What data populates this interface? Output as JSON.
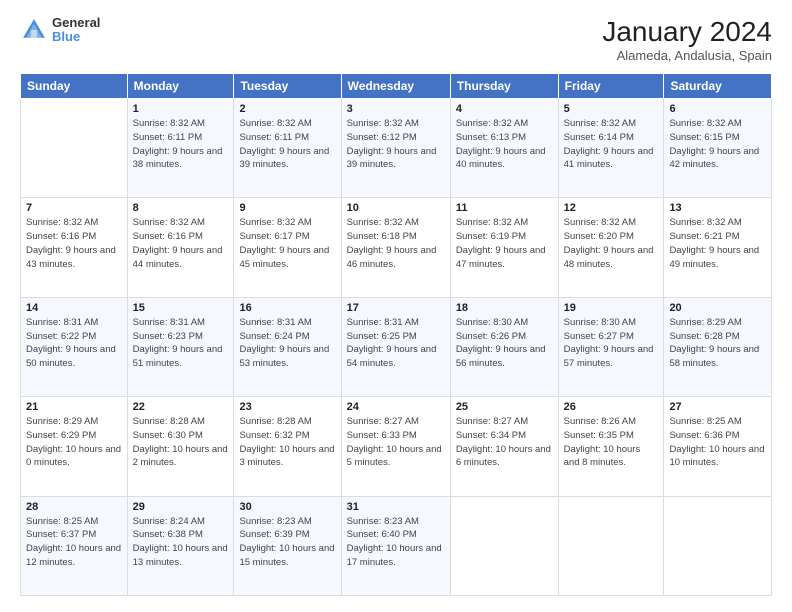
{
  "header": {
    "logo": {
      "line1": "General",
      "line2": "Blue"
    },
    "title": "January 2024",
    "subtitle": "Alameda, Andalusia, Spain"
  },
  "days_of_week": [
    "Sunday",
    "Monday",
    "Tuesday",
    "Wednesday",
    "Thursday",
    "Friday",
    "Saturday"
  ],
  "weeks": [
    [
      {
        "day": "",
        "sunrise": "",
        "sunset": "",
        "daylight": ""
      },
      {
        "day": "1",
        "sunrise": "Sunrise: 8:32 AM",
        "sunset": "Sunset: 6:11 PM",
        "daylight": "Daylight: 9 hours and 38 minutes."
      },
      {
        "day": "2",
        "sunrise": "Sunrise: 8:32 AM",
        "sunset": "Sunset: 6:11 PM",
        "daylight": "Daylight: 9 hours and 39 minutes."
      },
      {
        "day": "3",
        "sunrise": "Sunrise: 8:32 AM",
        "sunset": "Sunset: 6:12 PM",
        "daylight": "Daylight: 9 hours and 39 minutes."
      },
      {
        "day": "4",
        "sunrise": "Sunrise: 8:32 AM",
        "sunset": "Sunset: 6:13 PM",
        "daylight": "Daylight: 9 hours and 40 minutes."
      },
      {
        "day": "5",
        "sunrise": "Sunrise: 8:32 AM",
        "sunset": "Sunset: 6:14 PM",
        "daylight": "Daylight: 9 hours and 41 minutes."
      },
      {
        "day": "6",
        "sunrise": "Sunrise: 8:32 AM",
        "sunset": "Sunset: 6:15 PM",
        "daylight": "Daylight: 9 hours and 42 minutes."
      }
    ],
    [
      {
        "day": "7",
        "sunrise": "Sunrise: 8:32 AM",
        "sunset": "Sunset: 6:16 PM",
        "daylight": "Daylight: 9 hours and 43 minutes."
      },
      {
        "day": "8",
        "sunrise": "Sunrise: 8:32 AM",
        "sunset": "Sunset: 6:16 PM",
        "daylight": "Daylight: 9 hours and 44 minutes."
      },
      {
        "day": "9",
        "sunrise": "Sunrise: 8:32 AM",
        "sunset": "Sunset: 6:17 PM",
        "daylight": "Daylight: 9 hours and 45 minutes."
      },
      {
        "day": "10",
        "sunrise": "Sunrise: 8:32 AM",
        "sunset": "Sunset: 6:18 PM",
        "daylight": "Daylight: 9 hours and 46 minutes."
      },
      {
        "day": "11",
        "sunrise": "Sunrise: 8:32 AM",
        "sunset": "Sunset: 6:19 PM",
        "daylight": "Daylight: 9 hours and 47 minutes."
      },
      {
        "day": "12",
        "sunrise": "Sunrise: 8:32 AM",
        "sunset": "Sunset: 6:20 PM",
        "daylight": "Daylight: 9 hours and 48 minutes."
      },
      {
        "day": "13",
        "sunrise": "Sunrise: 8:32 AM",
        "sunset": "Sunset: 6:21 PM",
        "daylight": "Daylight: 9 hours and 49 minutes."
      }
    ],
    [
      {
        "day": "14",
        "sunrise": "Sunrise: 8:31 AM",
        "sunset": "Sunset: 6:22 PM",
        "daylight": "Daylight: 9 hours and 50 minutes."
      },
      {
        "day": "15",
        "sunrise": "Sunrise: 8:31 AM",
        "sunset": "Sunset: 6:23 PM",
        "daylight": "Daylight: 9 hours and 51 minutes."
      },
      {
        "day": "16",
        "sunrise": "Sunrise: 8:31 AM",
        "sunset": "Sunset: 6:24 PM",
        "daylight": "Daylight: 9 hours and 53 minutes."
      },
      {
        "day": "17",
        "sunrise": "Sunrise: 8:31 AM",
        "sunset": "Sunset: 6:25 PM",
        "daylight": "Daylight: 9 hours and 54 minutes."
      },
      {
        "day": "18",
        "sunrise": "Sunrise: 8:30 AM",
        "sunset": "Sunset: 6:26 PM",
        "daylight": "Daylight: 9 hours and 56 minutes."
      },
      {
        "day": "19",
        "sunrise": "Sunrise: 8:30 AM",
        "sunset": "Sunset: 6:27 PM",
        "daylight": "Daylight: 9 hours and 57 minutes."
      },
      {
        "day": "20",
        "sunrise": "Sunrise: 8:29 AM",
        "sunset": "Sunset: 6:28 PM",
        "daylight": "Daylight: 9 hours and 58 minutes."
      }
    ],
    [
      {
        "day": "21",
        "sunrise": "Sunrise: 8:29 AM",
        "sunset": "Sunset: 6:29 PM",
        "daylight": "Daylight: 10 hours and 0 minutes."
      },
      {
        "day": "22",
        "sunrise": "Sunrise: 8:28 AM",
        "sunset": "Sunset: 6:30 PM",
        "daylight": "Daylight: 10 hours and 2 minutes."
      },
      {
        "day": "23",
        "sunrise": "Sunrise: 8:28 AM",
        "sunset": "Sunset: 6:32 PM",
        "daylight": "Daylight: 10 hours and 3 minutes."
      },
      {
        "day": "24",
        "sunrise": "Sunrise: 8:27 AM",
        "sunset": "Sunset: 6:33 PM",
        "daylight": "Daylight: 10 hours and 5 minutes."
      },
      {
        "day": "25",
        "sunrise": "Sunrise: 8:27 AM",
        "sunset": "Sunset: 6:34 PM",
        "daylight": "Daylight: 10 hours and 6 minutes."
      },
      {
        "day": "26",
        "sunrise": "Sunrise: 8:26 AM",
        "sunset": "Sunset: 6:35 PM",
        "daylight": "Daylight: 10 hours and 8 minutes."
      },
      {
        "day": "27",
        "sunrise": "Sunrise: 8:25 AM",
        "sunset": "Sunset: 6:36 PM",
        "daylight": "Daylight: 10 hours and 10 minutes."
      }
    ],
    [
      {
        "day": "28",
        "sunrise": "Sunrise: 8:25 AM",
        "sunset": "Sunset: 6:37 PM",
        "daylight": "Daylight: 10 hours and 12 minutes."
      },
      {
        "day": "29",
        "sunrise": "Sunrise: 8:24 AM",
        "sunset": "Sunset: 6:38 PM",
        "daylight": "Daylight: 10 hours and 13 minutes."
      },
      {
        "day": "30",
        "sunrise": "Sunrise: 8:23 AM",
        "sunset": "Sunset: 6:39 PM",
        "daylight": "Daylight: 10 hours and 15 minutes."
      },
      {
        "day": "31",
        "sunrise": "Sunrise: 8:23 AM",
        "sunset": "Sunset: 6:40 PM",
        "daylight": "Daylight: 10 hours and 17 minutes."
      },
      {
        "day": "",
        "sunrise": "",
        "sunset": "",
        "daylight": ""
      },
      {
        "day": "",
        "sunrise": "",
        "sunset": "",
        "daylight": ""
      },
      {
        "day": "",
        "sunrise": "",
        "sunset": "",
        "daylight": ""
      }
    ]
  ]
}
